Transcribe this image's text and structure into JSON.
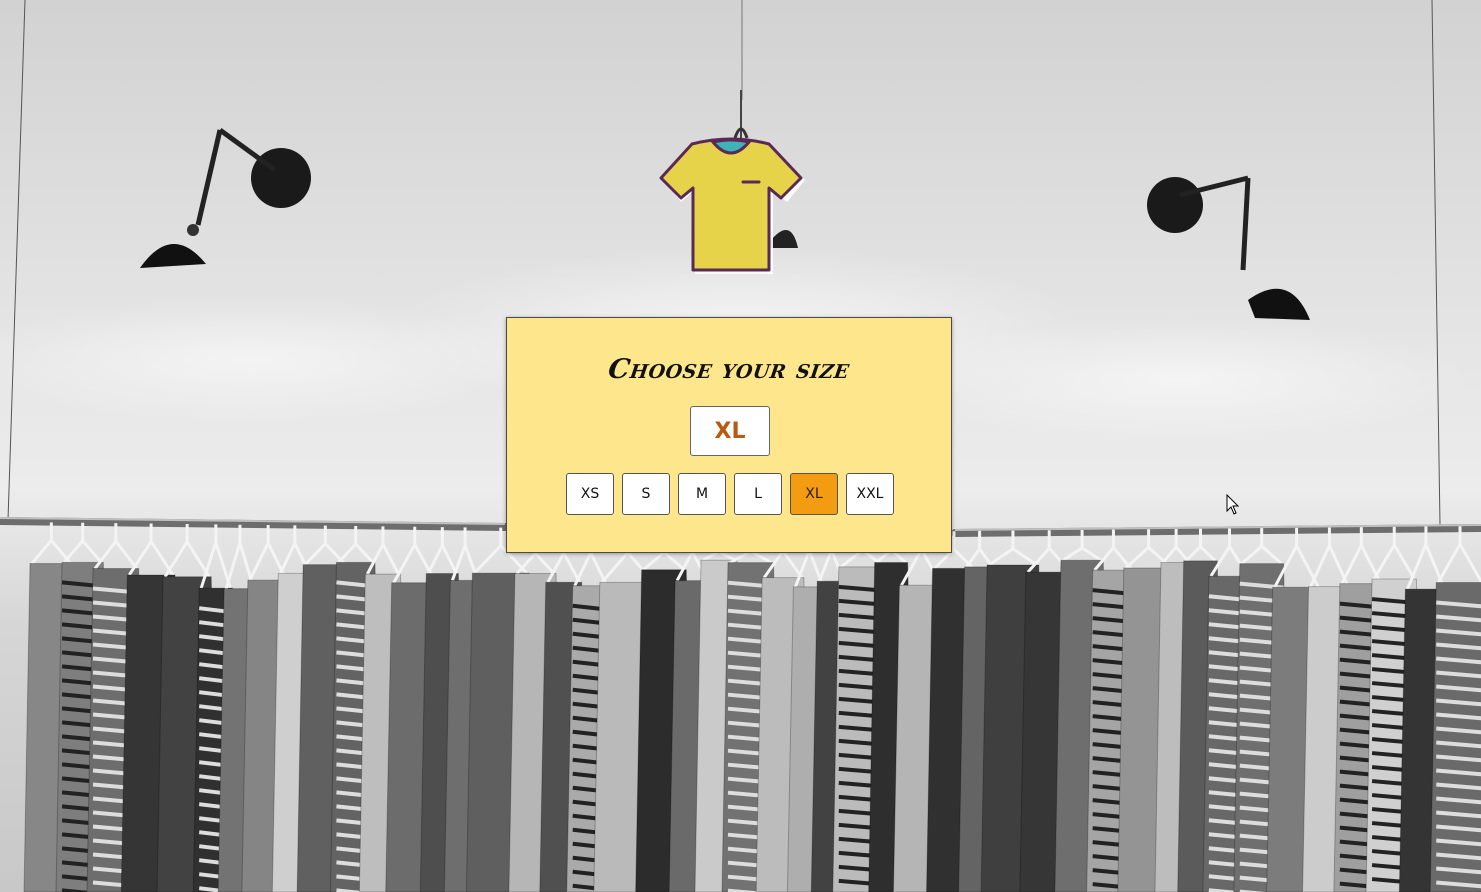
{
  "card": {
    "title": "Choose your size",
    "selected_size": "XL"
  },
  "sizes": [
    {
      "label": "XS",
      "active": false
    },
    {
      "label": "S",
      "active": false
    },
    {
      "label": "M",
      "active": false
    },
    {
      "label": "L",
      "active": false
    },
    {
      "label": "XL",
      "active": true
    },
    {
      "label": "XXL",
      "active": false
    }
  ],
  "icons": {
    "shirt": "tshirt-icon",
    "lamp": "wall-lamp",
    "cursor": "mouse-pointer-icon"
  },
  "colors": {
    "card_background": "#fee68c",
    "active_size": "#f39c12",
    "selected_text": "#b85a10",
    "shirt_fill": "#e6d34a",
    "shirt_collar": "#3fb3b8",
    "shirt_outline": "#5a2a55"
  }
}
